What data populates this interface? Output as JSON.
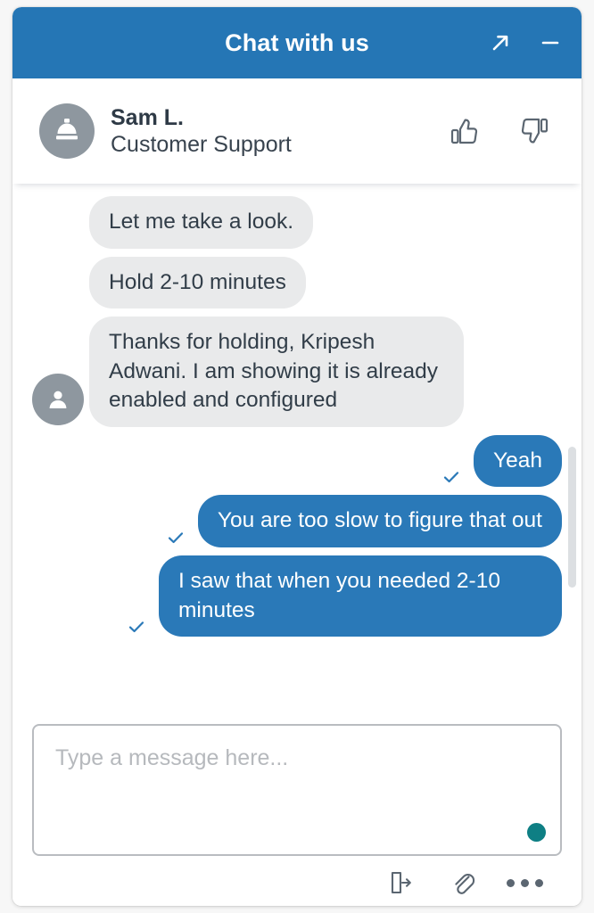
{
  "header": {
    "title": "Chat with us",
    "expand_icon": "expand-arrow-icon",
    "minimize_icon": "minimize-icon"
  },
  "agent": {
    "avatar_icon": "service-bell-icon",
    "name": "Sam L.",
    "role": "Customer Support",
    "thumbs_up_icon": "thumbs-up-icon",
    "thumbs_down_icon": "thumbs-down-icon"
  },
  "messages": [
    {
      "direction": "incoming",
      "text": "Let me take a look.",
      "avatar": false,
      "read": false
    },
    {
      "direction": "incoming",
      "text": "Hold 2-10 minutes",
      "avatar": false,
      "read": false
    },
    {
      "direction": "incoming",
      "text": "Thanks for holding, Kripesh Adwani. I am showing it is already enabled and configured",
      "avatar": true,
      "read": false
    },
    {
      "direction": "outgoing",
      "text": "Yeah",
      "avatar": false,
      "read": true
    },
    {
      "direction": "outgoing",
      "text": "You are too slow to figure that out",
      "avatar": false,
      "read": true
    },
    {
      "direction": "outgoing",
      "text": "I saw that when you needed 2-10 minutes",
      "avatar": false,
      "read": true
    }
  ],
  "composer": {
    "placeholder": "Type a message here...",
    "value": "",
    "status_dot_color": "#0e7f84",
    "tools": [
      {
        "name": "exit-chat-icon"
      },
      {
        "name": "attachment-icon"
      },
      {
        "name": "more-options-icon"
      }
    ]
  },
  "colors": {
    "brand_blue": "#2576b5",
    "bubble_out": "#2a79b8",
    "bubble_in": "#e9eaeb",
    "avatar_gray": "#8e979f",
    "text_dark": "#2e3a46",
    "teal": "#0e7f84"
  }
}
